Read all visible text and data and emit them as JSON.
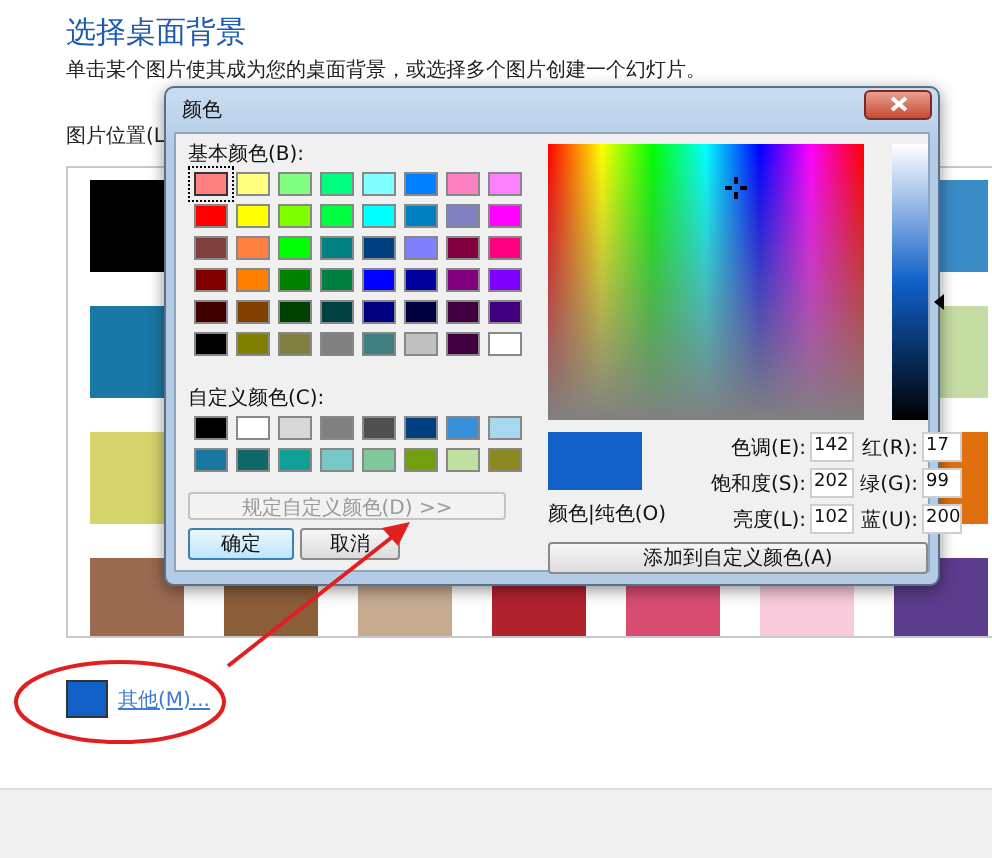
{
  "page": {
    "title": "选择桌面背景",
    "description": "单击某个图片使其成为您的桌面背景，或选择多个图片创建一个幻灯片。",
    "location_label": "图片位置(L",
    "swatch_rows": [
      [
        {
          "color": "#000000"
        },
        {
          "color": "#3a8bc6"
        }
      ],
      [
        {
          "color": "#1a78a6"
        },
        {
          "color": "#c4dba2"
        }
      ],
      [
        {
          "color": "#d6d46c"
        },
        {
          "color": "#e0700e"
        }
      ],
      [
        {
          "color": "#9a6a50"
        },
        {
          "color": "#8a5e38"
        },
        {
          "color": "#c6ab90"
        },
        {
          "color": "#b0222e"
        },
        {
          "color": "#d84c72"
        },
        {
          "color": "#f8cadb"
        },
        {
          "color": "#5c3c8c"
        }
      ]
    ],
    "current_swatch": {
      "color": "#1060c8"
    },
    "other_link": "其他(M)..."
  },
  "dialog": {
    "title": "颜色",
    "basic_label": "基本颜色(B):",
    "basic_colors": [
      {
        "color": "#ff8080",
        "selected": true
      },
      {
        "color": "#ffff80",
        "selected": false
      },
      {
        "color": "#80ff80",
        "selected": false
      },
      {
        "color": "#00ff80",
        "selected": false
      },
      {
        "color": "#80ffff",
        "selected": false
      },
      {
        "color": "#0080ff",
        "selected": false
      },
      {
        "color": "#ff80c0",
        "selected": false
      },
      {
        "color": "#ff80ff",
        "selected": false
      },
      {
        "color": "#ff0000",
        "selected": false
      },
      {
        "color": "#ffff00",
        "selected": false
      },
      {
        "color": "#80ff00",
        "selected": false
      },
      {
        "color": "#00ff40",
        "selected": false
      },
      {
        "color": "#00ffff",
        "selected": false
      },
      {
        "color": "#0080c0",
        "selected": false
      },
      {
        "color": "#8080c0",
        "selected": false
      },
      {
        "color": "#ff00ff",
        "selected": false
      },
      {
        "color": "#804040",
        "selected": false
      },
      {
        "color": "#ff8040",
        "selected": false
      },
      {
        "color": "#00ff00",
        "selected": false
      },
      {
        "color": "#008080",
        "selected": false
      },
      {
        "color": "#004080",
        "selected": false
      },
      {
        "color": "#8080ff",
        "selected": false
      },
      {
        "color": "#800040",
        "selected": false
      },
      {
        "color": "#ff0080",
        "selected": false
      },
      {
        "color": "#800000",
        "selected": false
      },
      {
        "color": "#ff8000",
        "selected": false
      },
      {
        "color": "#008000",
        "selected": false
      },
      {
        "color": "#008040",
        "selected": false
      },
      {
        "color": "#0000ff",
        "selected": false
      },
      {
        "color": "#0000a0",
        "selected": false
      },
      {
        "color": "#800080",
        "selected": false
      },
      {
        "color": "#8000ff",
        "selected": false
      },
      {
        "color": "#400000",
        "selected": false
      },
      {
        "color": "#804000",
        "selected": false
      },
      {
        "color": "#004000",
        "selected": false
      },
      {
        "color": "#004040",
        "selected": false
      },
      {
        "color": "#000080",
        "selected": false
      },
      {
        "color": "#000040",
        "selected": false
      },
      {
        "color": "#400040",
        "selected": false
      },
      {
        "color": "#400080",
        "selected": false
      },
      {
        "color": "#000000",
        "selected": false
      },
      {
        "color": "#808000",
        "selected": false
      },
      {
        "color": "#808040",
        "selected": false
      },
      {
        "color": "#808080",
        "selected": false
      },
      {
        "color": "#408080",
        "selected": false
      },
      {
        "color": "#c0c0c0",
        "selected": false
      },
      {
        "color": "#400040",
        "selected": false
      },
      {
        "color": "#ffffff",
        "selected": false
      }
    ],
    "custom_label": "自定义颜色(C):",
    "custom_colors": [
      {
        "color": "#000000"
      },
      {
        "color": "#ffffff"
      },
      {
        "color": "#d8d8d8"
      },
      {
        "color": "#808080"
      },
      {
        "color": "#505050"
      },
      {
        "color": "#004080"
      },
      {
        "color": "#3890d8"
      },
      {
        "color": "#a8d8f0"
      },
      {
        "color": "#1878a0"
      },
      {
        "color": "#106868"
      },
      {
        "color": "#10a098"
      },
      {
        "color": "#78c8c8"
      },
      {
        "color": "#80c898"
      },
      {
        "color": "#70a010"
      },
      {
        "color": "#c0e0a0"
      },
      {
        "color": "#8a8a20"
      }
    ],
    "define_button": {
      "label": "规定自定义颜色(D) >>",
      "disabled": true
    },
    "ok_button": "确定",
    "cancel_button": "取消",
    "hue_marker": {
      "level": 0.594
    },
    "saturation_marker": {
      "level": 0.842
    },
    "luminance_slider": {
      "level": 0.425
    },
    "preview": {
      "color": "#1060c8"
    },
    "color_solid_label": "颜色|纯色(O)",
    "fields": [
      {
        "label": "色调(E):",
        "value": "142"
      },
      {
        "label": "红(R):",
        "value": "17"
      },
      {
        "label": "饱和度(S):",
        "value": "202"
      },
      {
        "label": "绿(G):",
        "value": "99"
      },
      {
        "label": "亮度(L):",
        "value": "102"
      },
      {
        "label": "蓝(U):",
        "value": "200"
      }
    ],
    "add_button": "添加到自定义颜色(A)"
  }
}
